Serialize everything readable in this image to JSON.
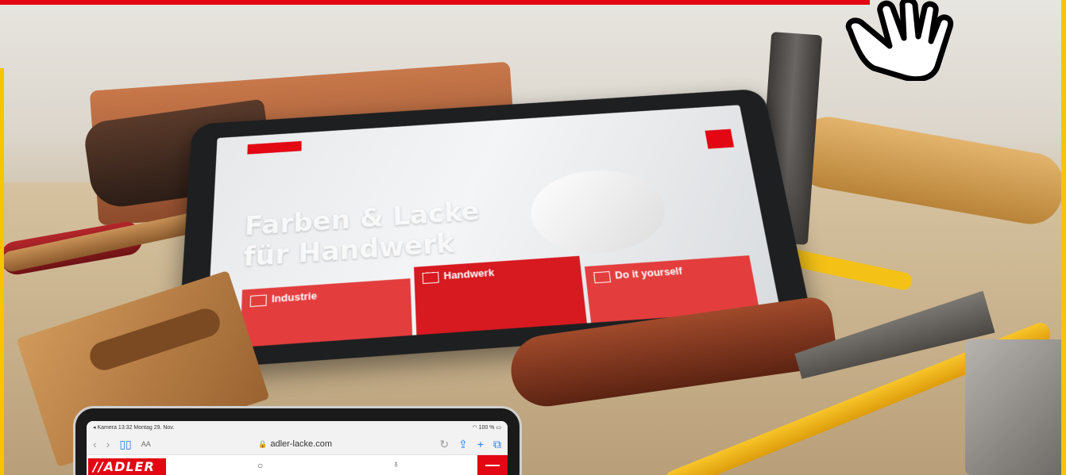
{
  "ipad": {
    "status": {
      "back_app": "◂ Kamera",
      "time": "13:32",
      "date": "Montag 29. Nov.",
      "battery": "100 %"
    },
    "browser": {
      "aa_label": "AA",
      "url": "adler-lacke.com"
    },
    "site": {
      "logo_text": "//ADLER"
    }
  },
  "tablet": {
    "headline_line1": "Farben & Lacke",
    "headline_line2": "für Handwerk",
    "tiles": [
      {
        "title": "Industrie"
      },
      {
        "title": "Handwerk"
      },
      {
        "title": "Do it yourself"
      }
    ]
  },
  "colors": {
    "brand_red": "#e30613",
    "accent_yellow": "#f6c500"
  },
  "icons": [
    "hand-pointer-icon",
    "book-icon",
    "lock-icon",
    "reload-icon",
    "share-icon",
    "plus-icon",
    "tabs-icon",
    "search-icon",
    "user-icon",
    "menu-icon"
  ]
}
